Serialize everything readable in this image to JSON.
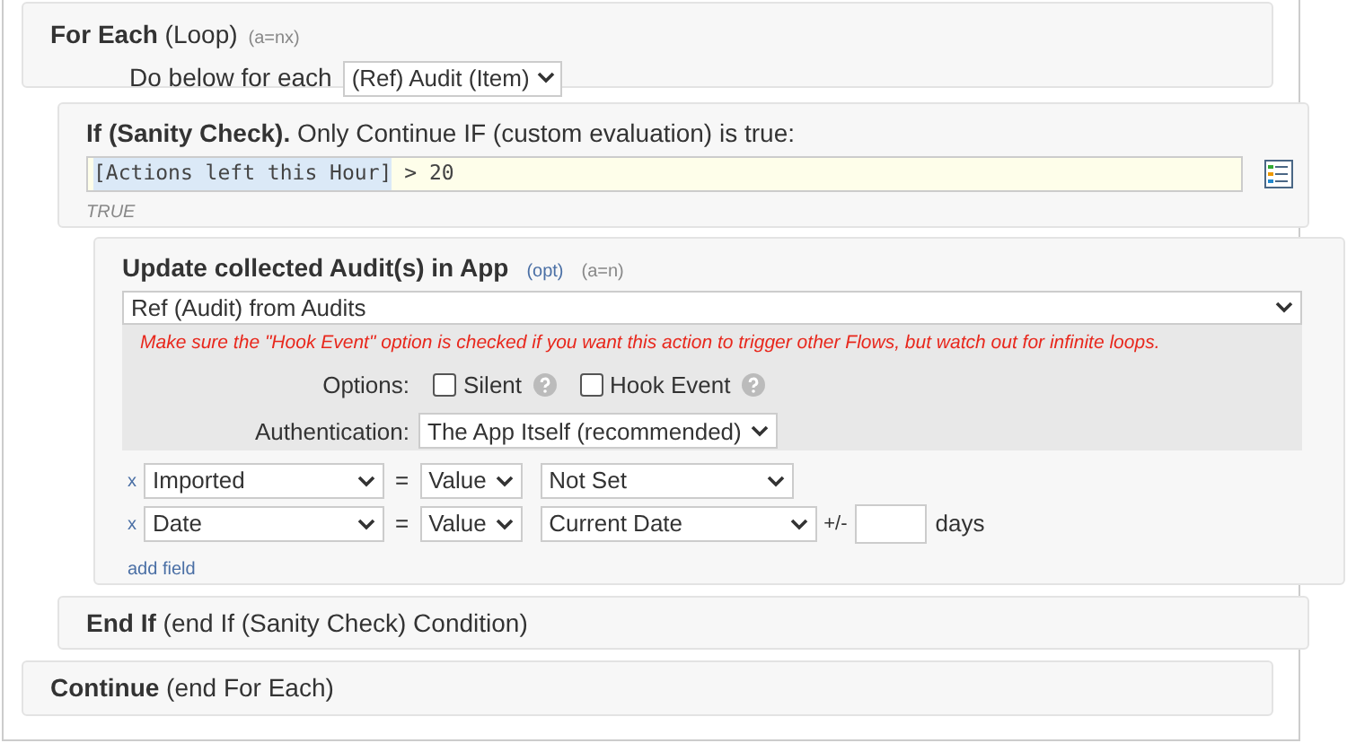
{
  "for_each": {
    "title": "For Each",
    "subtitle": "(Loop)",
    "code": "(a=nx)",
    "label": "Do below for each",
    "select": "(Ref) Audit (Item)"
  },
  "if_block": {
    "title": "If (Sanity Check).",
    "subtitle": "Only Continue IF (custom evaluation) is true:",
    "expression_token": "[Actions left this Hour]",
    "expression_rest": " > 20",
    "result": "TRUE"
  },
  "update": {
    "title": "Update collected Audit(s) in App",
    "opt": "(opt)",
    "code": "(a=n)",
    "source": "Ref (Audit) from Audits",
    "warning": "Make sure the \"Hook Event\" option is checked if you want this action to trigger other Flows, but watch out for infinite loops.",
    "options_label": "Options:",
    "options": [
      {
        "label": "Silent",
        "checked": false
      },
      {
        "label": "Hook Event",
        "checked": false
      }
    ],
    "auth_label": "Authentication:",
    "auth": "The App Itself (recommended)",
    "fields": [
      {
        "remove": "x",
        "field": "Imported",
        "eq": "=",
        "mode": "Value",
        "value": "Not Set",
        "kind": "plain"
      },
      {
        "remove": "x",
        "field": "Date",
        "eq": "=",
        "mode": "Value",
        "value": "Current Date",
        "kind": "offset",
        "offset_label": "+/-",
        "unit": "days"
      }
    ],
    "add_field": "add field"
  },
  "end_if": {
    "title": "End If",
    "subtitle": "(end If (Sanity Check) Condition)"
  },
  "continue": {
    "title": "Continue",
    "subtitle": "(end For Each)"
  }
}
